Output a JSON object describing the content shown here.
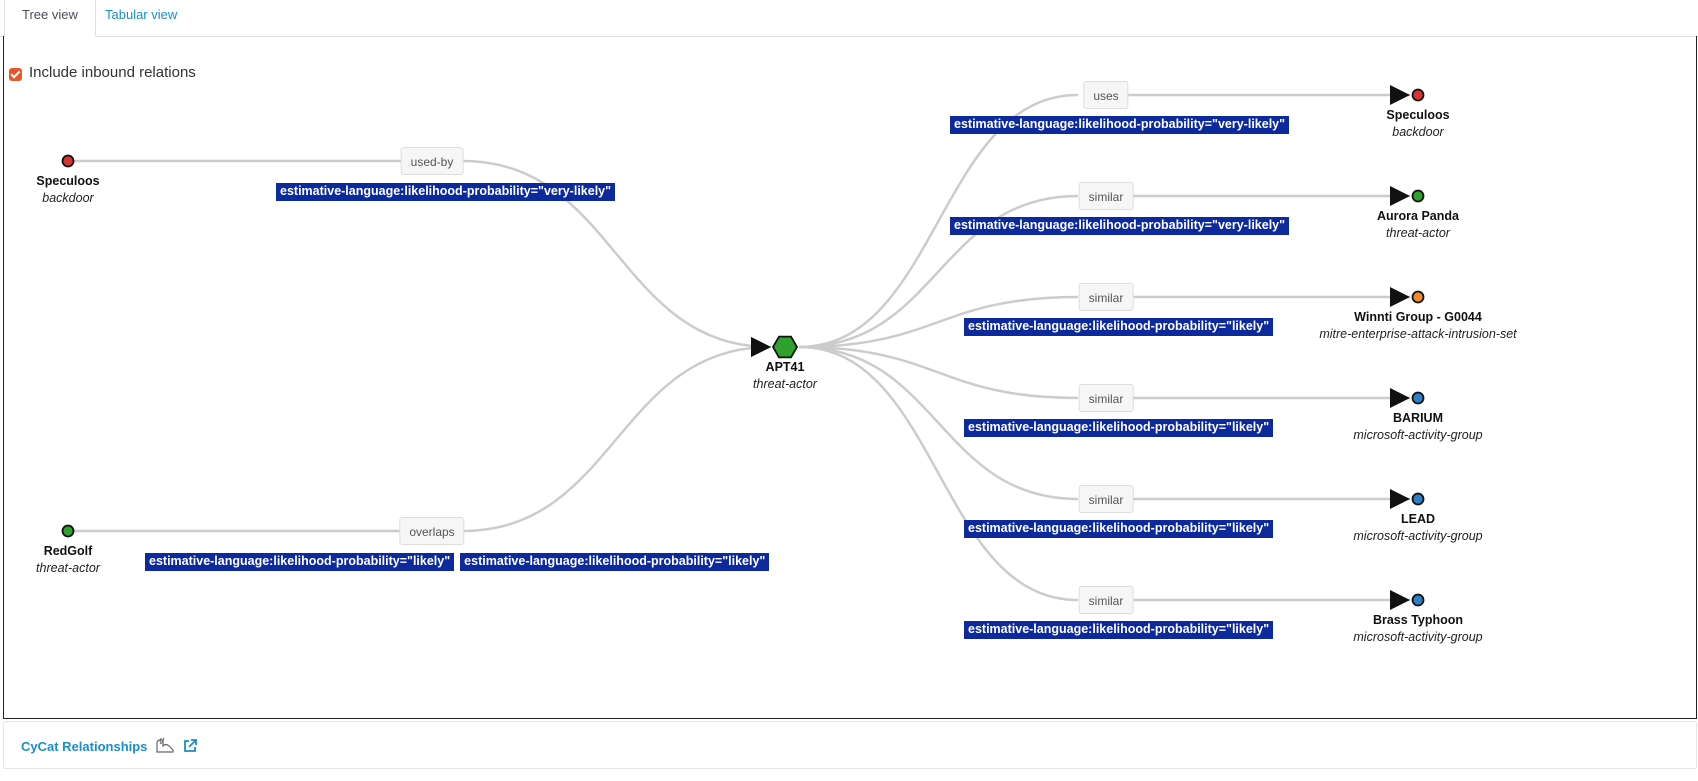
{
  "tabs": [
    {
      "label": "Tree view",
      "active": true
    },
    {
      "label": "Tabular view",
      "active": false
    }
  ],
  "inbound_checkbox": {
    "label": "Include inbound relations",
    "checked": true
  },
  "center": {
    "name": "APT41",
    "type": "threat-actor",
    "color": "#2ea12e"
  },
  "left_nodes": [
    {
      "name": "Speculoos",
      "type": "backdoor",
      "color": "#d93434",
      "relation": "used-by",
      "tags": [
        "estimative-language:likelihood-probability=\"very-likely\""
      ]
    },
    {
      "name": "RedGolf",
      "type": "threat-actor",
      "color": "#2ea12e",
      "relation": "overlaps",
      "tags": [
        "estimative-language:likelihood-probability=\"likely\"",
        "estimative-language:likelihood-probability=\"likely\""
      ]
    }
  ],
  "right_nodes": [
    {
      "name": "Speculoos",
      "type": "backdoor",
      "color": "#d93434",
      "relation": "uses",
      "tags": [
        "estimative-language:likelihood-probability=\"very-likely\""
      ]
    },
    {
      "name": "Aurora Panda",
      "type": "threat-actor",
      "color": "#2ea12e",
      "relation": "similar",
      "tags": [
        "estimative-language:likelihood-probability=\"very-likely\""
      ]
    },
    {
      "name": "Winnti Group - G0044",
      "type": "mitre-enterprise-attack-intrusion-set",
      "color": "#f08a28",
      "relation": "similar",
      "tags": [
        "estimative-language:likelihood-probability=\"likely\""
      ]
    },
    {
      "name": "BARIUM",
      "type": "microsoft-activity-group",
      "color": "#2e7fc9",
      "relation": "similar",
      "tags": [
        "estimative-language:likelihood-probability=\"likely\""
      ]
    },
    {
      "name": "LEAD",
      "type": "microsoft-activity-group",
      "color": "#2e7fc9",
      "relation": "similar",
      "tags": [
        "estimative-language:likelihood-probability=\"likely\""
      ]
    },
    {
      "name": "Brass Typhoon",
      "type": "microsoft-activity-group",
      "color": "#2e7fc9",
      "relation": "similar",
      "tags": [
        "estimative-language:likelihood-probability=\"likely\""
      ]
    }
  ],
  "footer": {
    "title": "CyCat Relationships",
    "icons": [
      "cycat-logo-icon",
      "external-link-icon"
    ],
    "accent": "#1a8ec9"
  },
  "colors": {
    "tag_bg": "#0d2a9c",
    "edge": "#cccccc",
    "checkbox": "#e8572a"
  }
}
